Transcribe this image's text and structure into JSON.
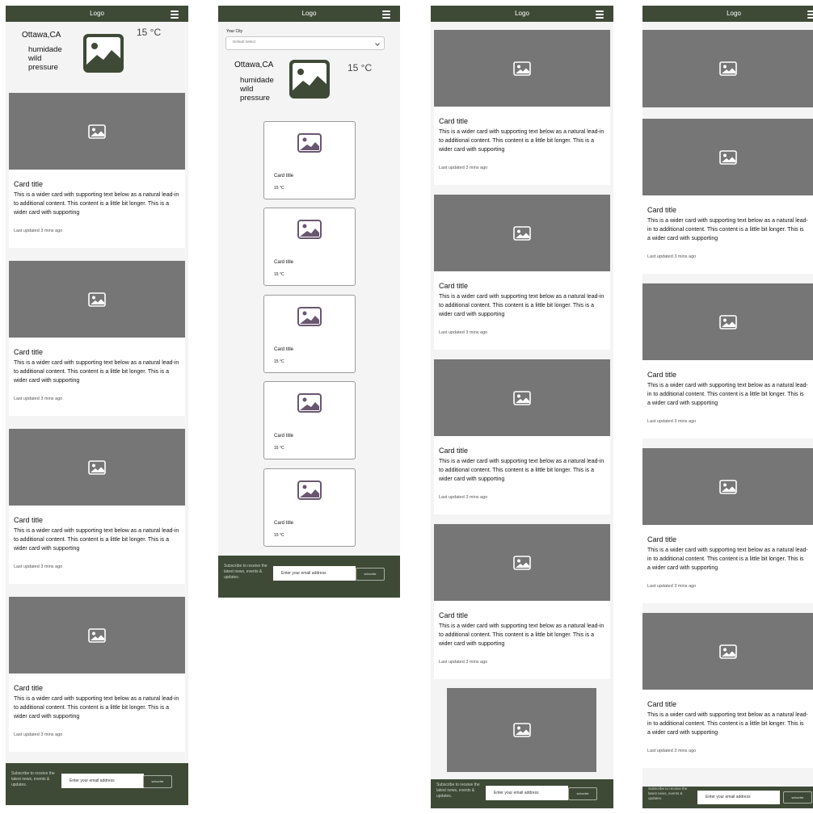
{
  "nav": {
    "logo": "Logo",
    "menu_icon": "hamburger-menu-icon"
  },
  "weather": {
    "city": "Ottawa,CA",
    "humidity_label": "humidade",
    "wind_label": "wild",
    "pressure_label": "pressure",
    "temperature": "15 °C",
    "icon": "image-placeholder-icon"
  },
  "city_select": {
    "label": "Your City",
    "selected": "Default Select"
  },
  "card": {
    "title": "Card title",
    "body": "This is a wider card with supporting text below as a natural lead-in to additional content. This content is a little bit longer. This is a wider card with supporting",
    "updated": "Last updated 3 mins ago"
  },
  "mini_card": {
    "title": "Card title",
    "temperature": "15 °C"
  },
  "footer": {
    "subscribe_text": "Subscribe to receive the latest news, events & updates.",
    "email_placeholder": "Enter your email address",
    "subscribe_button": "subscribe"
  },
  "colors": {
    "nav": "#3e4a36",
    "image_placeholder": "#767676",
    "mini_icon": "#6a5670",
    "page_bg": "#f4f4f4"
  }
}
